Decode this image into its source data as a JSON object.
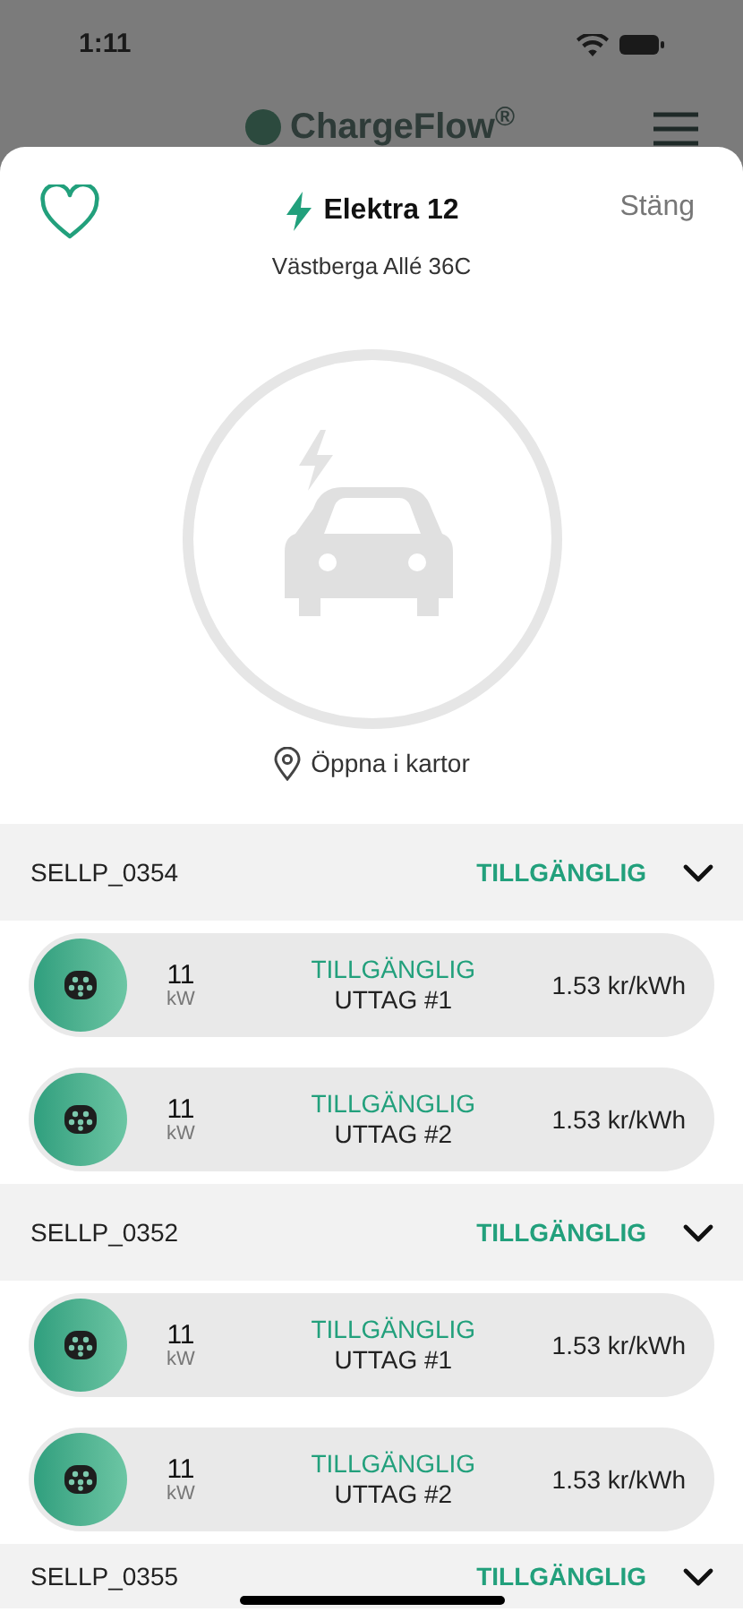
{
  "status_bar": {
    "time": "1:11"
  },
  "background_app": {
    "logo": "ChargeFlow$^{®}$"
  },
  "sheet": {
    "favorite": false,
    "title": "Elektra 12",
    "address": "Västberga Allé 36C",
    "close": "Stäng",
    "maps_link": "Öppna i kartor"
  },
  "stations": [
    {
      "id": "SELLP_0354",
      "status": "TILLGÄNGLIG",
      "expanded": true,
      "outlets": [
        {
          "power": "11",
          "unit": "kW",
          "status": "TILLGÄNGLIG",
          "name": "UTTAG #1",
          "price": "1.53 kr/kWh"
        },
        {
          "power": "11",
          "unit": "kW",
          "status": "TILLGÄNGLIG",
          "name": "UTTAG #2",
          "price": "1.53 kr/kWh"
        }
      ]
    },
    {
      "id": "SELLP_0352",
      "status": "TILLGÄNGLIG",
      "expanded": true,
      "outlets": [
        {
          "power": "11",
          "unit": "kW",
          "status": "TILLGÄNGLIG",
          "name": "UTTAG #1",
          "price": "1.53 kr/kWh"
        },
        {
          "power": "11",
          "unit": "kW",
          "status": "TILLGÄNGLIG",
          "name": "UTTAG #2",
          "price": "1.53 kr/kWh"
        }
      ]
    },
    {
      "id": "SELLP_0355",
      "status": "TILLGÄNGLIG",
      "expanded": true
    }
  ]
}
